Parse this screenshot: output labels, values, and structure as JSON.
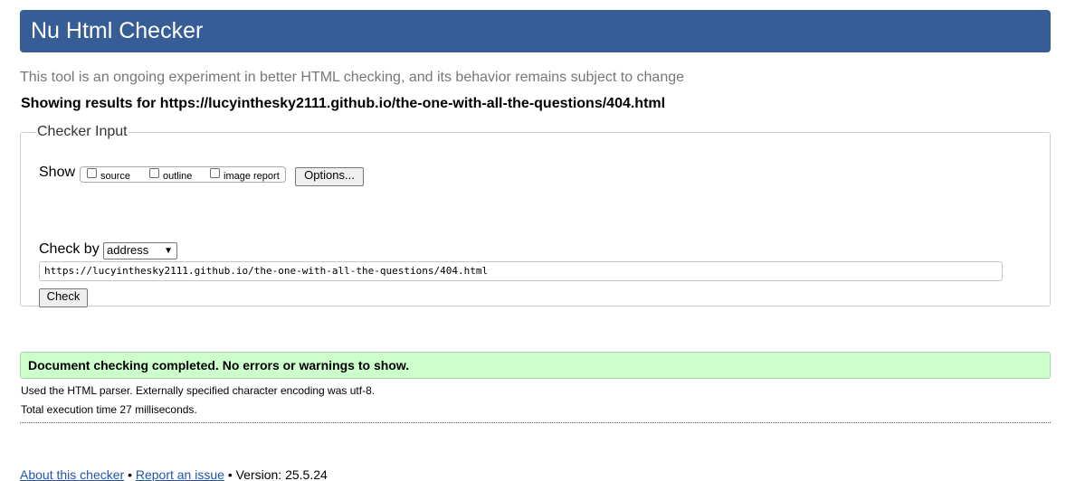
{
  "header": {
    "title": "Nu Html Checker"
  },
  "tagline": "This tool is an ongoing experiment in better HTML checking, and its behavior remains subject to change",
  "results_for": "Showing results for https://lucyinthesky2111.github.io/the-one-with-all-the-questions/404.html",
  "checker_input": {
    "legend": "Checker Input",
    "show_label": "Show",
    "options": [
      {
        "label": "source",
        "checked": false
      },
      {
        "label": "outline",
        "checked": false
      },
      {
        "label": "image report",
        "checked": false
      }
    ],
    "options_button": "Options...",
    "check_by_label": "Check by",
    "check_by_value": "address",
    "url_value": "https://lucyinthesky2111.github.io/the-one-with-all-the-questions/404.html",
    "check_button": "Check"
  },
  "result": {
    "success_message": "Document checking completed. No errors or warnings to show.",
    "parser_note": "Used the HTML parser. Externally specified character encoding was utf-8.",
    "timing_note": "Total execution time 27 milliseconds."
  },
  "footer": {
    "about_link": "About this checker",
    "separator": "•",
    "report_link": "Report an issue",
    "version_text": "Version: 25.5.24"
  },
  "colors": {
    "header_bg": "#365d95",
    "success_bg": "#ccffcc",
    "link": "#2255aa"
  }
}
